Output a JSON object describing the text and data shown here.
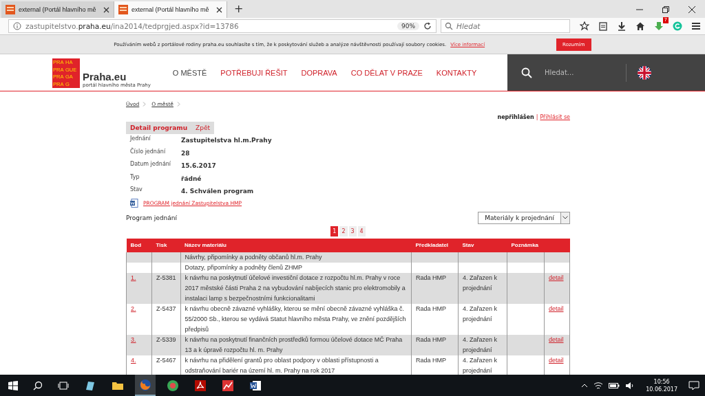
{
  "browser": {
    "tabs": [
      {
        "title": "external (Portál hlavního mě",
        "selected": false
      },
      {
        "title": "external (Portál hlavního mě",
        "selected": true
      }
    ],
    "new_tab": "+",
    "url": {
      "host_pre": "zastupitelstvo.",
      "host": "praha.eu",
      "path": "/ina2014/tedprgjed.aspx?id=13786"
    },
    "zoom": "90%",
    "search": {
      "placeholder": "Hledat"
    },
    "badge": "7"
  },
  "cookie_bar": {
    "text": "Používáním webů z portálové rodiny praha.eu souhlasíte s tím, že k poskytování služeb a analýze návštěvnosti používají soubory cookies.",
    "link": "Více informací",
    "button": "Rozumím"
  },
  "site": {
    "logo_cells": [
      "PRA",
      "HA",
      "PRA",
      "GUE",
      "PRA",
      "GA",
      "PRA",
      "G"
    ],
    "logo_title": "Praha.eu",
    "logo_subtitle": "portál hlavního města Prahy",
    "nav": [
      {
        "label": "O MĚSTĚ",
        "selected": true
      },
      {
        "label": "POTŘEBUJI ŘEŠIT",
        "selected": false
      },
      {
        "label": "DOPRAVA",
        "selected": false
      },
      {
        "label": "CO DĚLAT V PRAZE",
        "selected": false
      },
      {
        "label": "KONTAKTY",
        "selected": false
      }
    ],
    "search": {
      "placeholder": "Hledat..."
    }
  },
  "breadcrumb": [
    "Úvod",
    "O městě"
  ],
  "login": {
    "status": "nepřihlášen",
    "separator": "|",
    "link": "Přihlásit se"
  },
  "detail_tabs": [
    {
      "label": "Detail programu",
      "selected": true
    },
    {
      "label": "Zpět",
      "selected": false
    }
  ],
  "details": [
    {
      "label": "Jednání",
      "value": "Zastupitelstva hl.m.Prahy"
    },
    {
      "label": "Číslo jednání",
      "value": "28"
    },
    {
      "label": "Datum jednání",
      "value": "15.6.2017"
    },
    {
      "label": "Typ",
      "value": "řádné"
    },
    {
      "label": "Stav",
      "value": "4. Schválen program"
    }
  ],
  "document_link": "PROGRAM jednání Zastupitelstva HMP",
  "program_title": "Program jednání",
  "filter": {
    "value": "Materiály k projednání"
  },
  "pages": [
    {
      "label": "1",
      "selected": true
    },
    {
      "label": "2",
      "selected": false
    },
    {
      "label": "3",
      "selected": false
    },
    {
      "label": "4",
      "selected": false
    }
  ],
  "table": {
    "columns": [
      "Bod",
      "Tisk",
      "Název materiálu",
      "Předkladatel",
      "Stav",
      "Poznámka"
    ],
    "rows": [
      {
        "bod": "",
        "tisk": "",
        "nazev": "Návrhy, připomínky a podněty občanů hl.m. Prahy",
        "predkladatel": "",
        "stav": "",
        "detail": ""
      },
      {
        "bod": "",
        "tisk": "",
        "nazev": "Dotazy, připomínky a podněty členů ZHMP",
        "predkladatel": "",
        "stav": "",
        "detail": ""
      },
      {
        "bod": "1.",
        "tisk": "Z-5381",
        "nazev": "k návrhu na poskytnutí účelové investiční dotace z rozpočtu hl.m. Prahy v roce 2017 městské části Praha 2 na vybudování nabíjecích stanic pro elektromobily a instalaci lamp s bezpečnostními funkcionalitami",
        "predkladatel": "Rada HMP",
        "stav": "4. Zařazen k projednání",
        "detail": "detail"
      },
      {
        "bod": "2.",
        "tisk": "Z-5437",
        "nazev": "k návrhu obecně závazné vyhlášky, kterou se mění obecně závazné vyhláška č. 55/2000 Sb., kterou se vydává Statut hlavního města Prahy, ve znění pozdějších předpisů",
        "predkladatel": "Rada HMP",
        "stav": "4. Zařazen k projednání",
        "detail": "detail"
      },
      {
        "bod": "3.",
        "tisk": "Z-5339",
        "nazev": "k návrhu na poskytnutí finančních prostředků formou účelové dotace MČ Praha 13 a k úpravě rozpočtu hl. m. Prahy",
        "predkladatel": "Rada HMP",
        "stav": "4. Zařazen k projednání",
        "detail": "detail"
      },
      {
        "bod": "4.",
        "tisk": "Z-5467",
        "nazev": "k návrhu na přidělení grantů pro oblast podpory v oblasti přístupnosti a odstraňování bariér na území hl. m. Prahy na rok 2017",
        "predkladatel": "Rada HMP",
        "stav": "4. Zařazen k projednání",
        "detail": "detail"
      }
    ]
  },
  "taskbar": {
    "time": "10:56",
    "date": "10.06.2017"
  }
}
